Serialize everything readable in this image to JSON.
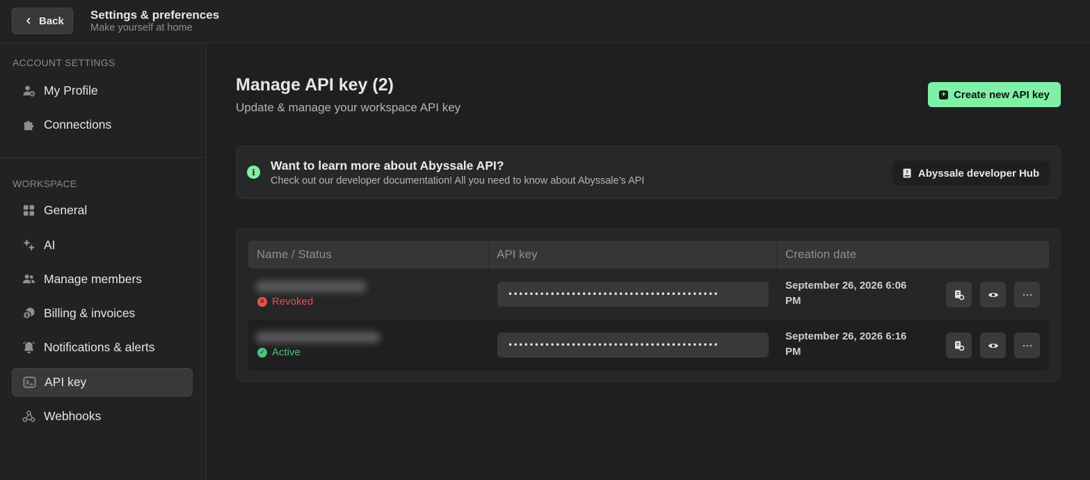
{
  "header": {
    "back_label": "Back",
    "title": "Settings & preferences",
    "subtitle": "Make yourself at home"
  },
  "sidebar": {
    "account_section": "ACCOUNT SETTINGS",
    "workspace_section": "WORKSPACE",
    "account_items": [
      {
        "label": "My Profile",
        "icon": "user-gear-icon"
      },
      {
        "label": "Connections",
        "icon": "puzzle-icon"
      }
    ],
    "workspace_items": [
      {
        "label": "General",
        "icon": "grid-icon"
      },
      {
        "label": "AI",
        "icon": "sparkles-icon"
      },
      {
        "label": "Manage members",
        "icon": "users-icon"
      },
      {
        "label": "Billing & invoices",
        "icon": "coins-icon"
      },
      {
        "label": "Notifications & alerts",
        "icon": "bell-icon"
      },
      {
        "label": "API key",
        "icon": "terminal-icon",
        "active": true
      },
      {
        "label": "Webhooks",
        "icon": "webhook-icon"
      }
    ]
  },
  "main": {
    "title": "Manage API key (2)",
    "subtitle": "Update & manage your workspace API key",
    "create_button": "Create new API key",
    "info": {
      "title": "Want to learn more about Abyssale API?",
      "text": "Check out our developer documentation! All you need to know about Abyssale’s API",
      "button": "Abyssale developer Hub"
    },
    "table": {
      "columns": [
        "Name / Status",
        "API key",
        "Creation date"
      ],
      "rows": [
        {
          "status": "Revoked",
          "status_color": "#e5534b",
          "key": "••••••••••••••••••••••••••••••••••••••••",
          "date": "September 26, 2026 6:06 PM"
        },
        {
          "status": "Active",
          "status_color": "#4cc27c",
          "key": "••••••••••••••••••••••••••••••••••••••••",
          "date": "September 26, 2026 6:16 PM"
        }
      ]
    }
  },
  "colors": {
    "accent": "#7ff0a6",
    "background": "#1f1f21",
    "revoked": "#e5534b",
    "active": "#4cc27c"
  }
}
